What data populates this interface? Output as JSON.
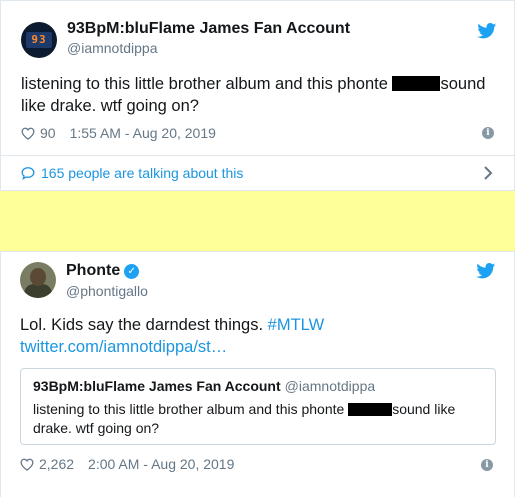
{
  "tweet1": {
    "name": "93BpM:bluFlame James Fan Account",
    "handle": "@iamnotdippa",
    "avatar_text": "93",
    "text_before": "listening to this little brother album and this phonte ",
    "text_after": "sound like drake. wtf going on?",
    "likes": "90",
    "timestamp": "1:55 AM - Aug 20, 2019",
    "talking": "165 people are talking about this"
  },
  "tweet2": {
    "name": "Phonte",
    "verified_icon": "✓",
    "handle": "@phontigallo",
    "text": "Lol. Kids say the darndest things. ",
    "hashtag": "#MTLW",
    "link": "twitter.com/iamnotdippa/st…",
    "likes": "2,262",
    "timestamp": "2:00 AM - Aug 20, 2019",
    "quote": {
      "name": "93BpM:bluFlame James Fan Account",
      "handle": "@iamnotdippa",
      "text_before": "listening to this little brother album and this phonte ",
      "text_after": "sound like drake. wtf going on?"
    }
  },
  "icons": {
    "info": "i",
    "bird": "twitter-bird-icon",
    "heart": "heart-icon",
    "bubble": "speech-bubble-icon",
    "chevron": "chevron-right-icon"
  },
  "colors": {
    "brand": "#1da1f2",
    "link": "#1b95e0",
    "muted": "#657786",
    "highlight": "#ffff99"
  }
}
